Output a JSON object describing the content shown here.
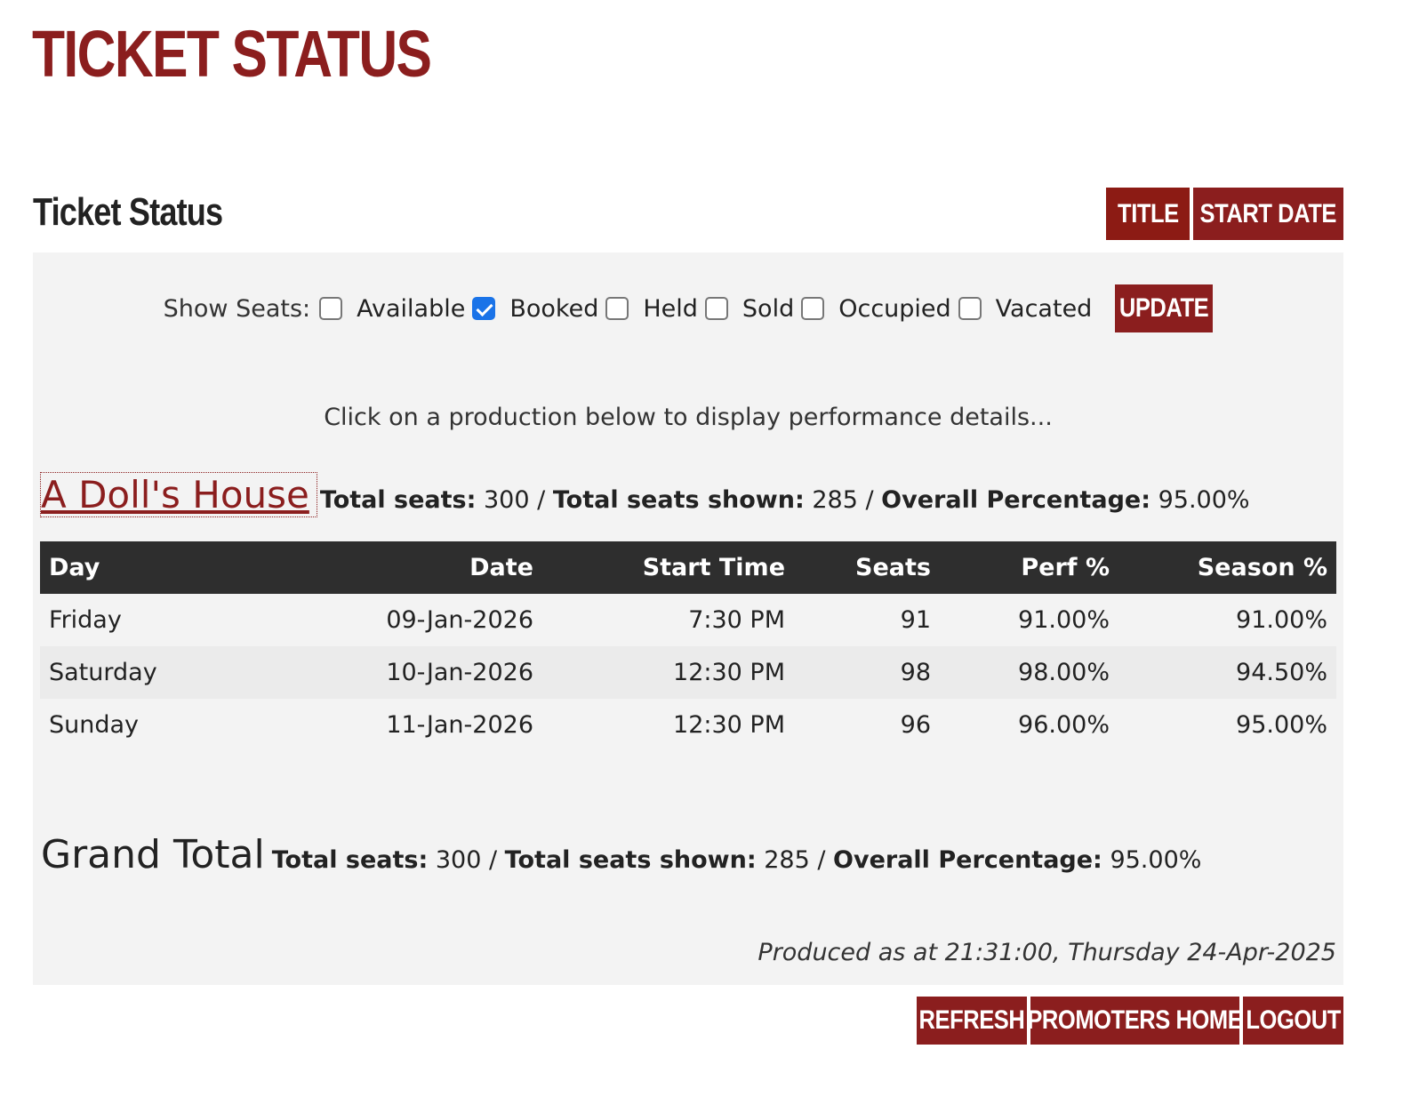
{
  "page": {
    "title": "TICKET STATUS"
  },
  "section": {
    "title": "Ticket Status",
    "sort_buttons": {
      "title": "TITLE",
      "start_date": "START DATE"
    }
  },
  "filters": {
    "label": "Show Seats:",
    "options": [
      {
        "label": "Available",
        "checked": false
      },
      {
        "label": "Booked",
        "checked": true
      },
      {
        "label": "Held",
        "checked": false
      },
      {
        "label": "Sold",
        "checked": false
      },
      {
        "label": "Occupied",
        "checked": false
      },
      {
        "label": "Vacated",
        "checked": false
      }
    ],
    "update_label": "UPDATE"
  },
  "hint": "Click on a production below to display performance details...",
  "production": {
    "name": "A Doll's House",
    "total_seats_label": "Total seats:",
    "total_seats": "300",
    "shown_label": "Total seats shown:",
    "shown": "285",
    "pct_label": "Overall Percentage:",
    "pct": "95.00%",
    "sep": " / "
  },
  "table": {
    "headers": [
      "Day",
      "Date",
      "Start Time",
      "Seats",
      "Perf %",
      "Season %"
    ],
    "rows": [
      [
        "Friday",
        "09-Jan-2026",
        "7:30 PM",
        "91",
        "91.00%",
        "91.00%"
      ],
      [
        "Saturday",
        "10-Jan-2026",
        "12:30 PM",
        "98",
        "98.00%",
        "94.50%"
      ],
      [
        "Sunday",
        "11-Jan-2026",
        "12:30 PM",
        "96",
        "96.00%",
        "95.00%"
      ]
    ]
  },
  "grand_total": {
    "label": "Grand Total",
    "total_seats_label": "Total seats:",
    "total_seats": "300",
    "shown_label": "Total seats shown:",
    "shown": "285",
    "pct_label": "Overall Percentage:",
    "pct": "95.00%",
    "sep": " / "
  },
  "produced": "Produced as at 21:31:00, Thursday 24-Apr-2025",
  "footer": {
    "refresh": "REFRESH",
    "promoters_home": "PROMOTERS HOME",
    "logout": "LOGOUT"
  },
  "colors": {
    "brand": "#8b1e1e",
    "header_bg": "#2e2e2e",
    "panel_bg": "#f3f3f3",
    "checkbox_checked": "#1a73e8"
  }
}
